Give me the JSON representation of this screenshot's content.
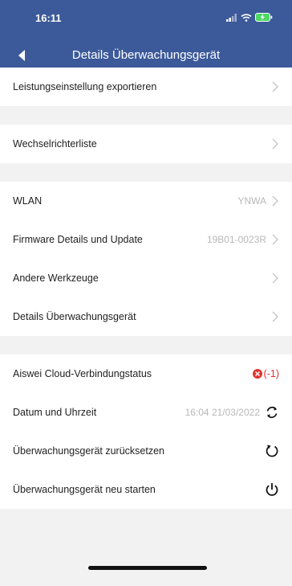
{
  "status_bar": {
    "time": "16:11"
  },
  "nav": {
    "title": "Details Überwachungsgerät"
  },
  "rows": {
    "export_power": {
      "label": "Leistungseinstellung exportieren"
    },
    "inverter_list": {
      "label": "Wechselrichterliste"
    },
    "wlan": {
      "label": "WLAN",
      "value": "YNWA"
    },
    "firmware": {
      "label": "Firmware Details und Update",
      "value": "19B01-0023R"
    },
    "other_tools": {
      "label": "Andere Werkzeuge"
    },
    "monitor_details": {
      "label": "Details Überwachungsgerät"
    },
    "cloud_status": {
      "label": "Aiswei Cloud-Verbindungstatus",
      "value": "(-1)"
    },
    "datetime": {
      "label": "Datum und Uhrzeit",
      "value": "16:04 21/03/2022"
    },
    "reset": {
      "label": "Überwachungsgerät zurücksetzen"
    },
    "restart": {
      "label": "Überwachungsgerät neu starten"
    }
  },
  "colors": {
    "header": "#3c5a9a",
    "error": "#e0332d",
    "muted": "#b8b8b8"
  },
  "icons": [
    "signal-icon",
    "wifi-icon",
    "battery-charging-icon",
    "back-icon",
    "chevron-right-icon",
    "error-icon",
    "sync-icon",
    "reset-icon",
    "power-icon"
  ]
}
